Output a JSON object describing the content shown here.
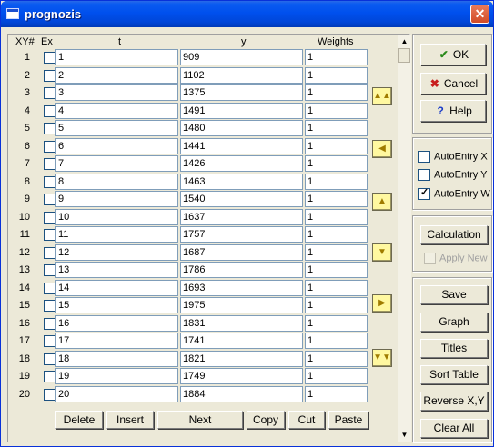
{
  "window": {
    "title": "prognozis",
    "close_glyph": "✕"
  },
  "table": {
    "headers": {
      "xy": "XY#",
      "ex": "Ex",
      "t": "t",
      "y": "y",
      "weights": "Weights"
    },
    "rows": [
      {
        "n": "1",
        "t": "1",
        "y": "909",
        "w": "1"
      },
      {
        "n": "2",
        "t": "2",
        "y": "1102",
        "w": "1"
      },
      {
        "n": "3",
        "t": "3",
        "y": "1375",
        "w": "1"
      },
      {
        "n": "4",
        "t": "4",
        "y": "1491",
        "w": "1"
      },
      {
        "n": "5",
        "t": "5",
        "y": "1480",
        "w": "1"
      },
      {
        "n": "6",
        "t": "6",
        "y": "1441",
        "w": "1"
      },
      {
        "n": "7",
        "t": "7",
        "y": "1426",
        "w": "1"
      },
      {
        "n": "8",
        "t": "8",
        "y": "1463",
        "w": "1"
      },
      {
        "n": "9",
        "t": "9",
        "y": "1540",
        "w": "1"
      },
      {
        "n": "10",
        "t": "10",
        "y": "1637",
        "w": "1"
      },
      {
        "n": "11",
        "t": "11",
        "y": "1757",
        "w": "1"
      },
      {
        "n": "12",
        "t": "12",
        "y": "1687",
        "w": "1"
      },
      {
        "n": "13",
        "t": "13",
        "y": "1786",
        "w": "1"
      },
      {
        "n": "14",
        "t": "14",
        "y": "1693",
        "w": "1"
      },
      {
        "n": "15",
        "t": "15",
        "y": "1975",
        "w": "1"
      },
      {
        "n": "16",
        "t": "16",
        "y": "1831",
        "w": "1"
      },
      {
        "n": "17",
        "t": "17",
        "y": "1741",
        "w": "1"
      },
      {
        "n": "18",
        "t": "18",
        "y": "1821",
        "w": "1"
      },
      {
        "n": "19",
        "t": "19",
        "y": "1749",
        "w": "1"
      },
      {
        "n": "20",
        "t": "20",
        "y": "1884",
        "w": "1"
      }
    ]
  },
  "nav_buttons": [
    {
      "name": "first-page-button",
      "glyph": "▲▲"
    },
    {
      "name": "left-button",
      "glyph": "◀"
    },
    {
      "name": "up-button",
      "glyph": "▲"
    },
    {
      "name": "down-button",
      "glyph": "▼"
    },
    {
      "name": "right-button",
      "glyph": "▶"
    },
    {
      "name": "last-page-button",
      "glyph": "▼▼"
    }
  ],
  "bottom_buttons": {
    "delete": "Delete",
    "insert": "Insert",
    "next": "Next",
    "copy": "Copy",
    "cut": "Cut",
    "paste": "Paste"
  },
  "dialog_buttons": {
    "ok": "OK",
    "cancel": "Cancel",
    "help": "Help"
  },
  "autoentry": {
    "x": {
      "label": "AutoEntry X",
      "checked": false
    },
    "y": {
      "label": "AutoEntry Y",
      "checked": false
    },
    "w": {
      "label": "AutoEntry W",
      "checked": true
    }
  },
  "calc": {
    "calculation": "Calculation",
    "apply_new": "Apply New",
    "apply_new_enabled": false
  },
  "actions": {
    "save": "Save",
    "graph": "Graph",
    "titles": "Titles",
    "sort_table": "Sort Table",
    "reverse_xy": "Reverse X,Y",
    "clear_all": "Clear All"
  },
  "icons": {
    "ok": "check-icon",
    "cancel": "x-icon",
    "help": "question-icon",
    "scroll_up": "scroll-up-arrow-icon",
    "scroll_down": "scroll-down-arrow-icon"
  },
  "colors": {
    "title_bar": "#0050ee",
    "nav_button_bg": "#fff8a0",
    "cell_border": "#7f9db9"
  }
}
